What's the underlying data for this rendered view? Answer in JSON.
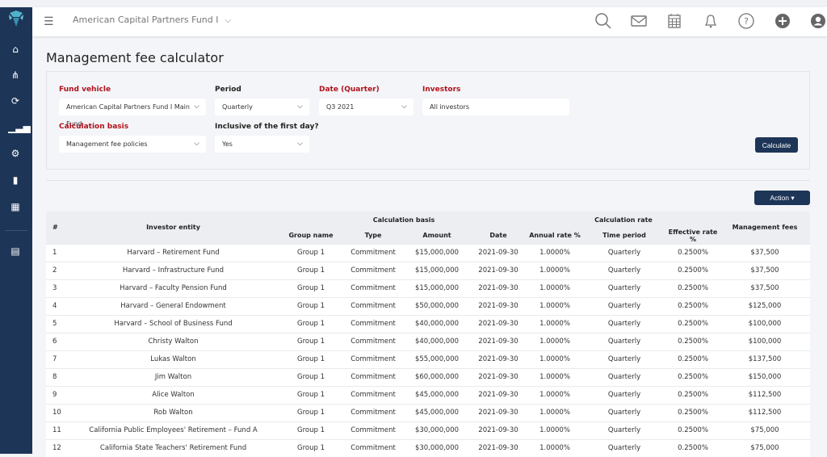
{
  "header": {
    "fund": "American Capital Partners Fund I",
    "icons": [
      "search-icon",
      "mail-icon",
      "calendar-icon",
      "bell-icon",
      "help-icon",
      "plus-icon",
      "user-icon"
    ]
  },
  "sidebar": {
    "icons": [
      "home-icon",
      "hierarchy-icon",
      "sync-icon",
      "signal-icon",
      "gears-icon",
      "book-icon",
      "calculator-icon",
      "document-icon"
    ]
  },
  "page": {
    "title": "Management fee calculator"
  },
  "filters": {
    "fund_vehicle": {
      "label": "Fund vehicle",
      "value": "American Capital Partners Fund I Main Fund"
    },
    "period": {
      "label": "Period",
      "value": "Quarterly"
    },
    "date": {
      "label": "Date (Quarter)",
      "value": "Q3 2021"
    },
    "investors": {
      "label": "Investors",
      "value": "All investors"
    },
    "calc_basis": {
      "label": "Calculation basis",
      "value": "Management fee policies"
    },
    "inclusive": {
      "label": "Inclusive of the first day?",
      "value": "Yes"
    },
    "calculate": "Calculate"
  },
  "action": "Action ▾",
  "table": {
    "headers": {
      "num": "#",
      "entity": "Investor entity",
      "calc_basis": "Calculation basis",
      "calc_rate": "Calculation rate",
      "fees": "Management fees",
      "group": "Group name",
      "type": "Type",
      "amount": "Amount",
      "date": "Date",
      "annual": "Annual rate %",
      "time": "Time period",
      "effective": "Effective rate %"
    },
    "rows": [
      [
        "1",
        "Harvard – Retirement Fund",
        "Group 1",
        "Commitment",
        "$15,000,000",
        "2021-09-30",
        "1.0000%",
        "Quarterly",
        "0.2500%",
        "$37,500"
      ],
      [
        "2",
        "Harvard – Infrastructure Fund",
        "Group 1",
        "Commitment",
        "$15,000,000",
        "2021-09-30",
        "1.0000%",
        "Quarterly",
        "0.2500%",
        "$37,500"
      ],
      [
        "3",
        "Harvard – Faculty Pension Fund",
        "Group 1",
        "Commitment",
        "$15,000,000",
        "2021-09-30",
        "1.0000%",
        "Quarterly",
        "0.2500%",
        "$37,500"
      ],
      [
        "4",
        "Harvard – General Endowment",
        "Group 1",
        "Commitment",
        "$50,000,000",
        "2021-09-30",
        "1.0000%",
        "Quarterly",
        "0.2500%",
        "$125,000"
      ],
      [
        "5",
        "Harvard – School of Business Fund",
        "Group 1",
        "Commitment",
        "$40,000,000",
        "2021-09-30",
        "1.0000%",
        "Quarterly",
        "0.2500%",
        "$100,000"
      ],
      [
        "6",
        "Christy Walton",
        "Group 1",
        "Commitment",
        "$40,000,000",
        "2021-09-30",
        "1.0000%",
        "Quarterly",
        "0.2500%",
        "$100,000"
      ],
      [
        "7",
        "Lukas Walton",
        "Group 1",
        "Commitment",
        "$55,000,000",
        "2021-09-30",
        "1.0000%",
        "Quarterly",
        "0.2500%",
        "$137,500"
      ],
      [
        "8",
        "Jim Walton",
        "Group 1",
        "Commitment",
        "$60,000,000",
        "2021-09-30",
        "1.0000%",
        "Quarterly",
        "0.2500%",
        "$150,000"
      ],
      [
        "9",
        "Alice Walton",
        "Group 1",
        "Commitment",
        "$45,000,000",
        "2021-09-30",
        "1.0000%",
        "Quarterly",
        "0.2500%",
        "$112,500"
      ],
      [
        "10",
        "Rob Walton",
        "Group 1",
        "Commitment",
        "$45,000,000",
        "2021-09-30",
        "1.0000%",
        "Quarterly",
        "0.2500%",
        "$112,500"
      ],
      [
        "11",
        "California Public Employees' Retirement – Fund A",
        "Group 1",
        "Commitment",
        "$30,000,000",
        "2021-09-30",
        "1.0000%",
        "Quarterly",
        "0.2500%",
        "$75,000"
      ],
      [
        "12",
        "California State Teachers' Retirement Fund",
        "Group 1",
        "Commitment",
        "$30,000,000",
        "2021-09-30",
        "1.0000%",
        "Quarterly",
        "0.2500%",
        "$75,000"
      ]
    ]
  }
}
